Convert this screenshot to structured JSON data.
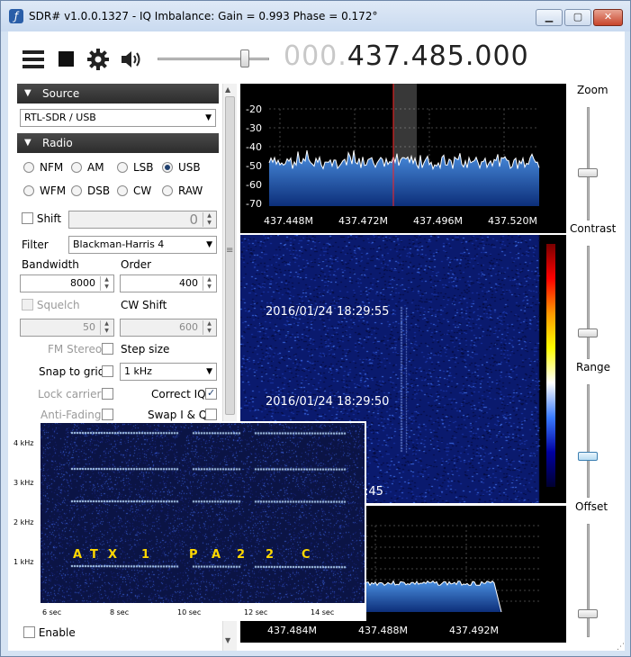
{
  "window": {
    "title": "SDR# v1.0.0.1327 - IQ Imbalance: Gain = 0.993 Phase = 0.172°",
    "buttons": {
      "minimize": "▁",
      "maximize": "▢",
      "close": "✕"
    }
  },
  "toolbar": {
    "menu_icon": "menu-icon",
    "stop_icon": "stop-icon",
    "settings_icon": "gear-icon",
    "volume_icon": "speaker-icon",
    "frequency_prefix": "000.",
    "frequency_main": "437.485.000"
  },
  "source": {
    "header": "Source",
    "device": "RTL-SDR / USB"
  },
  "radio": {
    "header": "Radio",
    "modes": [
      "NFM",
      "AM",
      "LSB",
      "USB",
      "WFM",
      "DSB",
      "CW",
      "RAW"
    ],
    "selected_mode": "USB",
    "shift_label": "Shift",
    "shift_value": "0",
    "filter_label": "Filter",
    "filter_value": "Blackman-Harris 4",
    "bandwidth_label": "Bandwidth",
    "bandwidth_value": "8000",
    "order_label": "Order",
    "order_value": "400",
    "squelch_label": "Squelch",
    "squelch_value": "50",
    "cw_shift_label": "CW Shift",
    "cw_shift_value": "600",
    "fm_stereo_label": "FM Stereo",
    "step_size_label": "Step size",
    "snap_label": "Snap to grid",
    "step_size_value": "1 kHz",
    "lock_carrier_label": "Lock carrier",
    "correct_iq_label": "Correct IQ",
    "anti_fading_label": "Anti-Fading",
    "swap_iq_label": "Swap I & Q"
  },
  "audio": {
    "enable_label": "Enable"
  },
  "spectrum": {
    "y_ticks": [
      "-20",
      "-30",
      "-40",
      "-50",
      "-60",
      "-70"
    ],
    "x_ticks": [
      "437.448M",
      "437.472M",
      "437.496M",
      "437.520M"
    ],
    "noise_floor_db": -48
  },
  "waterfall": {
    "timestamps": [
      "2016/01/24 18:29:55",
      "2016/01/24 18:29:50",
      ":45"
    ]
  },
  "bottom_spectrum": {
    "x_ticks": [
      "437.484M",
      "437.488M",
      "437.492M"
    ]
  },
  "sliders": {
    "zoom_label": "Zoom",
    "contrast_label": "Contrast",
    "range_label": "Range",
    "offset_label": "Offset"
  },
  "overlay_spectrogram": {
    "y_ticks": [
      "4 kHz",
      "3 kHz",
      "2 kHz",
      "1 kHz"
    ],
    "x_ticks": [
      "6 sec",
      "8 sec",
      "10 sec",
      "12 sec",
      "14 sec"
    ],
    "letters": [
      "A",
      "T",
      "X",
      "1",
      "P",
      "A",
      "2",
      "2",
      "C"
    ]
  },
  "colors": {
    "panel_header": "#333333",
    "spectrum_fill": "#1e5fb8",
    "waterfall_bg": "#0a1a6e",
    "marker": "#ff2020",
    "callsign": "#ffd800"
  }
}
